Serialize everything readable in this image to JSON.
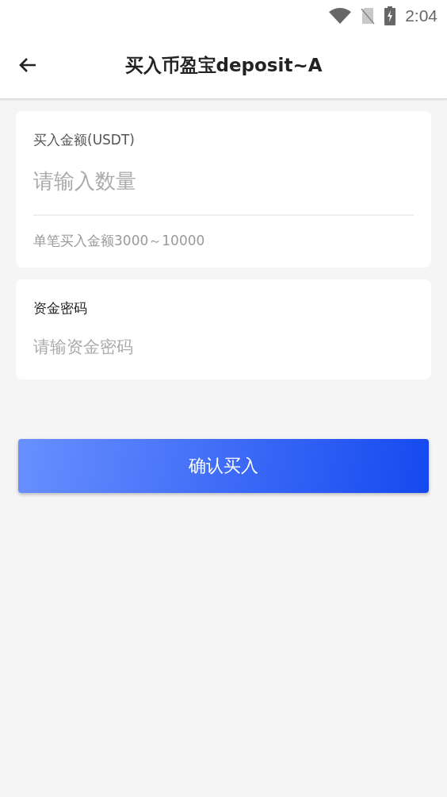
{
  "status_bar": {
    "time": "2:04"
  },
  "header": {
    "title": "买入币盈宝deposit~A"
  },
  "amount": {
    "label": "买入金额(USDT)",
    "placeholder": "请输入数量",
    "hint": "单笔买入金额3000～10000"
  },
  "password": {
    "label": "资金密码",
    "placeholder": "请输资金密码"
  },
  "submit": {
    "label": "确认买入"
  }
}
